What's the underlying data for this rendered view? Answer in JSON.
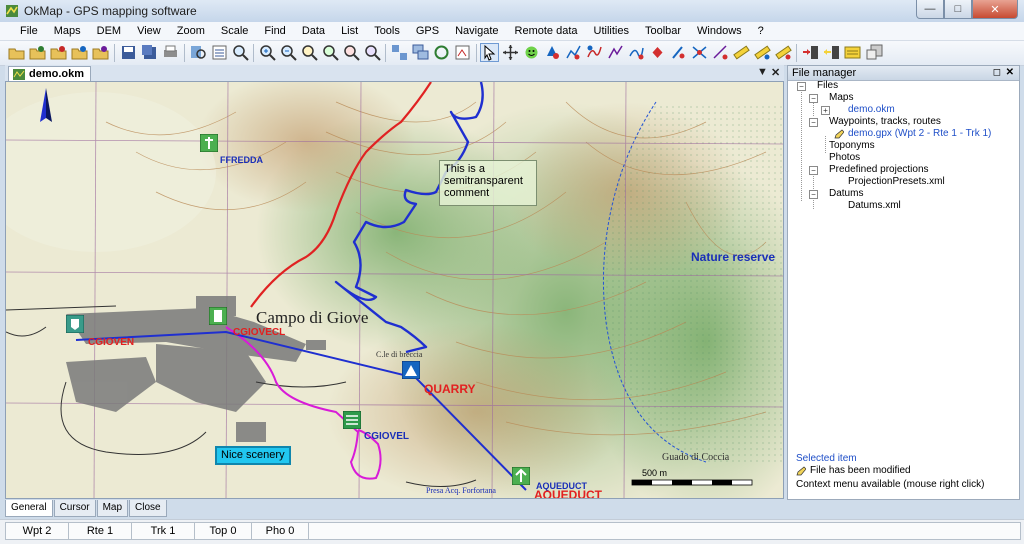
{
  "window": {
    "title": "OkMap - GPS mapping software"
  },
  "menu": [
    "File",
    "Maps",
    "DEM",
    "View",
    "Zoom",
    "Scale",
    "Find",
    "Data",
    "List",
    "Tools",
    "GPS",
    "Navigate",
    "Remote data",
    "Utilities",
    "Toolbar",
    "Windows",
    "?"
  ],
  "doc_tab": {
    "label": "demo.okm"
  },
  "map": {
    "note": "This is a semitransparent comment",
    "scenery": "Nice scenery",
    "place_labels": {
      "fredda": "FFREDDA",
      "campo": "Campo di Giove",
      "nature_reserve": "Nature reserve",
      "quarry": "QUARRY",
      "cgiovel": "CGIOVEL",
      "giovem": "CGIOVEN",
      "giovecl": "CGIOVECL",
      "aqueduct_blue": "AQUEDUCT",
      "aqueduct_red": "AQUEDUCT",
      "scale_text": "500 m",
      "coccia": "Guado di Coccia",
      "breccia": "C.le di breccia",
      "fontana": "Presa Acq. Forfortana"
    }
  },
  "file_manager": {
    "title": "File manager",
    "tree": {
      "files": "Files",
      "maps": "Maps",
      "map_file": "demo.okm",
      "wtr": "Waypoints, tracks, routes",
      "gpx_file": "demo.gpx (Wpt 2 - Rte 1 - Trk 1)",
      "toponyms": "Toponyms",
      "photos": "Photos",
      "projections": "Predefined projections",
      "proj_file": "ProjectionPresets.xml",
      "datums": "Datums",
      "datum_file": "Datums.xml"
    },
    "selected_title": "Selected item",
    "selected_status": "File has been modified",
    "selected_hint": "Context menu available (mouse right click)"
  },
  "bottom_tabs": [
    "General",
    "Cursor",
    "Map",
    "Close"
  ],
  "status": [
    "Wpt 2",
    "Rte 1",
    "Trk 1",
    "Top 0",
    "Pho 0"
  ]
}
